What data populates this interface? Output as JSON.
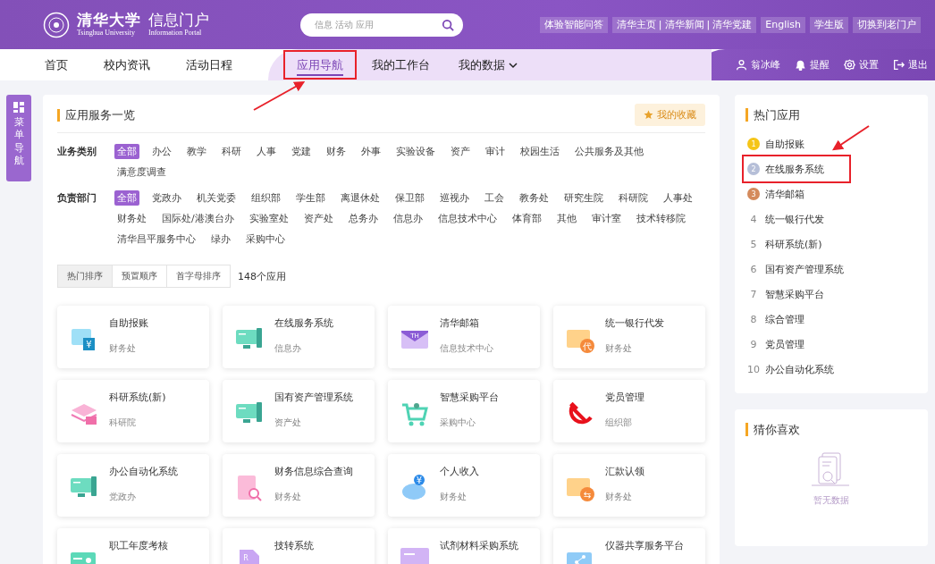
{
  "header": {
    "logo_name": "清华大学",
    "logo_subtitle": "Tsinghua University",
    "portal_title": "信息门户",
    "portal_subtitle": "Information Portal",
    "search": {
      "placeholder": "信息 活动 应用"
    },
    "top_links": [
      {
        "items": [
          "体验智能问答"
        ]
      },
      {
        "items": [
          "清华主页",
          "清华新闻",
          "清华党建"
        ],
        "separator": "|"
      },
      {
        "items": [
          "English"
        ]
      },
      {
        "items": [
          "学生版"
        ]
      },
      {
        "items": [
          "切换到老门户"
        ]
      }
    ]
  },
  "nav": {
    "left_tabs": [
      {
        "label": "首页",
        "selected": false
      },
      {
        "label": "校内资讯",
        "selected": false
      },
      {
        "label": "活动日程",
        "selected": false
      }
    ],
    "center_tabs": [
      {
        "label": "应用导航",
        "selected": true,
        "highlighted": true,
        "dropdown": false
      },
      {
        "label": "我的工作台",
        "selected": false,
        "highlighted": false,
        "dropdown": false
      },
      {
        "label": "我的数据",
        "selected": false,
        "highlighted": false,
        "dropdown": true
      }
    ],
    "user_actions": [
      {
        "kind": "user",
        "label": "翁冰峰"
      },
      {
        "kind": "bell",
        "label": "提醒"
      },
      {
        "kind": "gear",
        "label": "设置"
      },
      {
        "kind": "logout",
        "label": "退出"
      }
    ]
  },
  "side_menu": {
    "label": "菜单导航"
  },
  "apps": {
    "title": "应用服务一览",
    "favorites_button": "我的收藏",
    "filters": [
      {
        "label": "业务类别",
        "tags": [
          {
            "label": "全部",
            "selected": true
          },
          {
            "label": "办公",
            "selected": false
          },
          {
            "label": "教学",
            "selected": false
          },
          {
            "label": "科研",
            "selected": false
          },
          {
            "label": "人事",
            "selected": false
          },
          {
            "label": "党建",
            "selected": false
          },
          {
            "label": "财务",
            "selected": false
          },
          {
            "label": "外事",
            "selected": false
          },
          {
            "label": "实验设备",
            "selected": false
          },
          {
            "label": "资产",
            "selected": false
          },
          {
            "label": "审计",
            "selected": false
          },
          {
            "label": "校园生活",
            "selected": false
          },
          {
            "label": "公共服务及其他",
            "selected": false
          },
          {
            "label": "满意度调查",
            "selected": false
          }
        ]
      },
      {
        "label": "负责部门",
        "tags": [
          {
            "label": "全部",
            "selected": true
          },
          {
            "label": "党政办",
            "selected": false
          },
          {
            "label": "机关党委",
            "selected": false
          },
          {
            "label": "组织部",
            "selected": false
          },
          {
            "label": "学生部",
            "selected": false
          },
          {
            "label": "离退休处",
            "selected": false
          },
          {
            "label": "保卫部",
            "selected": false
          },
          {
            "label": "巡视办",
            "selected": false
          },
          {
            "label": "工会",
            "selected": false
          },
          {
            "label": "教务处",
            "selected": false
          },
          {
            "label": "研究生院",
            "selected": false
          },
          {
            "label": "科研院",
            "selected": false
          },
          {
            "label": "人事处",
            "selected": false
          },
          {
            "label": "财务处",
            "selected": false
          },
          {
            "label": "国际处/港澳台办",
            "selected": false
          },
          {
            "label": "实验室处",
            "selected": false
          },
          {
            "label": "资产处",
            "selected": false
          },
          {
            "label": "总务办",
            "selected": false
          },
          {
            "label": "信息办",
            "selected": false
          },
          {
            "label": "信息技术中心",
            "selected": false
          },
          {
            "label": "体育部",
            "selected": false
          },
          {
            "label": "其他",
            "selected": false
          },
          {
            "label": "审计室",
            "selected": false
          },
          {
            "label": "技术转移院",
            "selected": false
          },
          {
            "label": "清华昌平服务中心",
            "selected": false
          },
          {
            "label": "绿办",
            "selected": false
          },
          {
            "label": "采购中心",
            "selected": false
          }
        ]
      }
    ],
    "sort_tabs": [
      {
        "label": "热门排序",
        "selected": true
      },
      {
        "label": "预置顺序",
        "selected": false
      },
      {
        "label": "首字母排序",
        "selected": false
      }
    ],
    "count": "148个应用",
    "cards": [
      {
        "name": "自助报账",
        "dept": "财务处",
        "kind": "receipt",
        "icon_text": "¥"
      },
      {
        "name": "在线服务系统",
        "dept": "信息办",
        "kind": "monitor"
      },
      {
        "name": "清华邮箱",
        "dept": "信息技术中心",
        "kind": "mail",
        "icon_text": "TH"
      },
      {
        "name": "统一银行代发",
        "dept": "财务处",
        "kind": "card",
        "icon_text": "代"
      },
      {
        "name": "科研系统(新)",
        "dept": "科研院",
        "kind": "stack"
      },
      {
        "name": "国有资产管理系统",
        "dept": "资产处",
        "kind": "monitor"
      },
      {
        "name": "智慧采购平台",
        "dept": "采购中心",
        "kind": "cart"
      },
      {
        "name": "党员管理",
        "dept": "组织部",
        "kind": "party"
      },
      {
        "name": "办公自动化系统",
        "dept": "党政办",
        "kind": "monitor"
      },
      {
        "name": "财务信息综合查询",
        "dept": "财务处",
        "kind": "searchdoc"
      },
      {
        "name": "个人收入",
        "dept": "财务处",
        "kind": "piggy",
        "icon_text": "¥"
      },
      {
        "name": "汇款认领",
        "dept": "财务处",
        "kind": "card",
        "icon_text": "⇆"
      },
      {
        "name": "职工年度考核",
        "kind": "idcard"
      },
      {
        "name": "技转系统",
        "kind": "doc",
        "icon_text": "R"
      },
      {
        "name": "试剂材料采购系统",
        "kind": "folder"
      },
      {
        "name": "仪器共享服务平台",
        "kind": "share"
      }
    ]
  },
  "hot": {
    "title": "热门应用",
    "items": [
      {
        "rank": "1",
        "kind": "gold",
        "name": "自助报账",
        "highlighted": false
      },
      {
        "rank": "2",
        "kind": "silver",
        "name": "在线服务系统",
        "highlighted": true
      },
      {
        "rank": "3",
        "kind": "bronze",
        "name": "清华邮箱",
        "highlighted": false
      },
      {
        "rank": "4",
        "kind": "plain",
        "name": "统一银行代发",
        "highlighted": false
      },
      {
        "rank": "5",
        "kind": "plain",
        "name": "科研系统(新)",
        "highlighted": false
      },
      {
        "rank": "6",
        "kind": "plain",
        "name": "国有资产管理系统",
        "highlighted": false
      },
      {
        "rank": "7",
        "kind": "plain",
        "name": "智慧采购平台",
        "highlighted": false
      },
      {
        "rank": "8",
        "kind": "plain",
        "name": "综合管理",
        "highlighted": false
      },
      {
        "rank": "9",
        "kind": "plain",
        "name": "党员管理",
        "highlighted": false
      },
      {
        "rank": "10",
        "kind": "plain",
        "name": "办公自动化系统",
        "highlighted": false
      }
    ]
  },
  "guess": {
    "title": "猜你喜欢",
    "empty_text": "暂无数据"
  }
}
